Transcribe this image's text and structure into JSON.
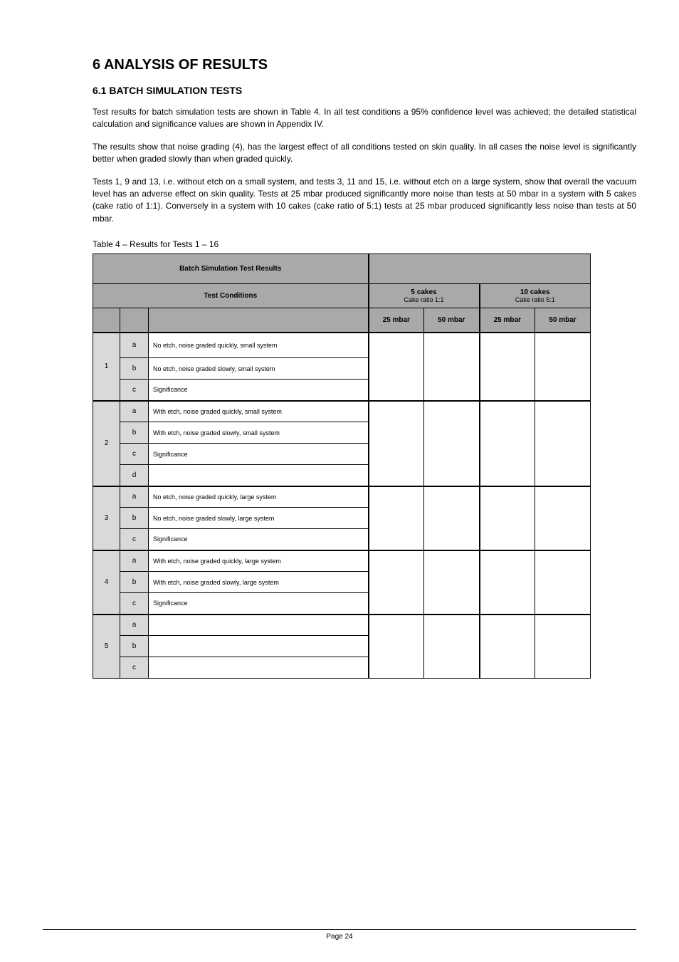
{
  "heading": "6  ANALYSIS OF RESULTS",
  "subheading": "6.1  BATCH SIMULATION TESTS",
  "paragraphs": {
    "p1": "Test results for batch simulation tests are shown in Table 4. In all test conditions a 95% confidence level was achieved; the detailed statistical calculation and significance values are shown in Appendix IV.",
    "p2": "The results show that noise grading (4), has the largest effect of all conditions tested on skin quality. In all cases the noise level is significantly better when graded slowly than when graded quickly.",
    "p3": "Tests 1, 9 and 13, i.e. without etch on a small system, and tests 3, 11 and 15, i.e. without etch on a large system, show that overall the vacuum level has an adverse effect on skin quality. Tests at 25 mbar produced significantly more noise than tests at 50 mbar in a system with 5 cakes (cake ratio of 1:1). Conversely in a system with 10 cakes (cake ratio of 5:1) tests at 25 mbar produced significantly less noise than tests at 50 mbar."
  },
  "table": {
    "caption": "Table 4 – Results for Tests 1 – 16",
    "superheader": "Batch Simulation Test Results",
    "header_groups": {
      "test_conditions": "Test Conditions",
      "five_cakes_label": "5 cakes",
      "five_cakes_sub": "Cake ratio 1:1",
      "ten_cakes_label": "10 cakes",
      "ten_cakes_sub": "Cake ratio 5:1"
    },
    "column_headers": {
      "c1": "",
      "c2": "",
      "c3": "",
      "vac25": "25 mbar",
      "vac50": "50 mbar",
      "vac25b": "25 mbar",
      "vac50b": "50 mbar"
    },
    "groups": [
      {
        "num": "1",
        "rows": [
          {
            "sub": "a",
            "desc": "No etch, noise graded quickly, small system",
            "v1": "",
            "v2": "",
            "v3": "",
            "v4": ""
          },
          {
            "sub": "b",
            "desc": "No etch, noise graded slowly, small system",
            "v1": "",
            "v2": "",
            "v3": "",
            "v4": ""
          },
          {
            "sub": "c",
            "desc": "Significance",
            "v1": "",
            "v2": "",
            "v3": "",
            "v4": ""
          }
        ]
      },
      {
        "num": "2",
        "rows": [
          {
            "sub": "a",
            "desc": "With etch, noise graded quickly, small system",
            "v1": "",
            "v2": "",
            "v3": "",
            "v4": ""
          },
          {
            "sub": "b",
            "desc": "With etch, noise graded slowly, small system",
            "v1": "",
            "v2": "",
            "v3": "",
            "v4": ""
          },
          {
            "sub": "c",
            "desc": "Significance",
            "v1": "",
            "v2": "",
            "v3": "",
            "v4": ""
          },
          {
            "sub": "d",
            "desc": "",
            "v1": "",
            "v2": "",
            "v3": "",
            "v4": ""
          }
        ]
      },
      {
        "num": "3",
        "rows": [
          {
            "sub": "a",
            "desc": "No etch, noise graded quickly, large system",
            "v1": "",
            "v2": "",
            "v3": "",
            "v4": ""
          },
          {
            "sub": "b",
            "desc": "No etch, noise graded slowly, large system",
            "v1": "",
            "v2": "",
            "v3": "",
            "v4": ""
          },
          {
            "sub": "c",
            "desc": "Significance",
            "v1": "",
            "v2": "",
            "v3": "",
            "v4": ""
          }
        ]
      },
      {
        "num": "4",
        "rows": [
          {
            "sub": "a",
            "desc": "With etch, noise graded quickly, large system",
            "v1": "",
            "v2": "",
            "v3": "",
            "v4": ""
          },
          {
            "sub": "b",
            "desc": "With etch, noise graded slowly, large system",
            "v1": "",
            "v2": "",
            "v3": "",
            "v4": ""
          },
          {
            "sub": "c",
            "desc": "Significance",
            "v1": "",
            "v2": "",
            "v3": "",
            "v4": ""
          }
        ]
      },
      {
        "num": "5",
        "rows": [
          {
            "sub": "a",
            "desc": "",
            "v1": "",
            "v2": "",
            "v3": "",
            "v4": ""
          },
          {
            "sub": "b",
            "desc": "",
            "v1": "",
            "v2": "",
            "v3": "",
            "v4": ""
          },
          {
            "sub": "c",
            "desc": "",
            "v1": "",
            "v2": "",
            "v3": "",
            "v4": ""
          }
        ]
      }
    ]
  },
  "footer": {
    "left": "",
    "center": "Page 24",
    "right": ""
  }
}
